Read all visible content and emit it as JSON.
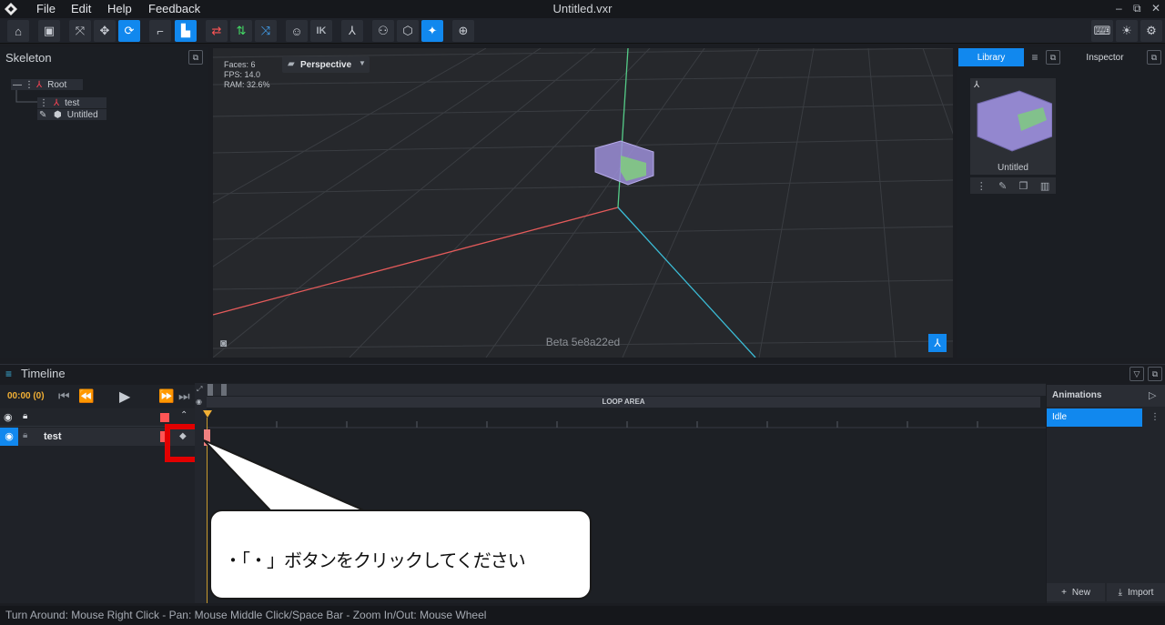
{
  "app": {
    "title": "Untitled.vxr",
    "menu": [
      "File",
      "Edit",
      "Help",
      "Feedback"
    ],
    "window_buttons": [
      "–",
      "⧉",
      "✕"
    ]
  },
  "toolbar": {
    "ik_label": "IK",
    "accent": "#1188ee"
  },
  "skeleton": {
    "title": "Skeleton",
    "root_label": "Root",
    "child_label": "test",
    "mesh_label": "Untitled"
  },
  "viewport": {
    "faces": "Faces: 6",
    "fps": "FPS: 14.0",
    "ram": "RAM: 32.6%",
    "mode": "Perspective",
    "beta": "Beta 5e8a22ed"
  },
  "library": {
    "tab_library": "Library",
    "tab_inspector": "Inspector",
    "item_label": "Untitled"
  },
  "timeline": {
    "title": "Timeline",
    "time": "00:00 (0)",
    "loop_area": "LOOP AREA",
    "track_name": "test"
  },
  "animations": {
    "title": "Animations",
    "items": [
      "Idle"
    ],
    "new_label": "New",
    "import_label": "Import"
  },
  "callout": {
    "text": "・「・」ボタンをクリックしてください"
  },
  "status": {
    "text": "Turn Around: Mouse Right Click - Pan: Mouse Middle Click/Space Bar - Zoom In/Out: Mouse Wheel"
  }
}
